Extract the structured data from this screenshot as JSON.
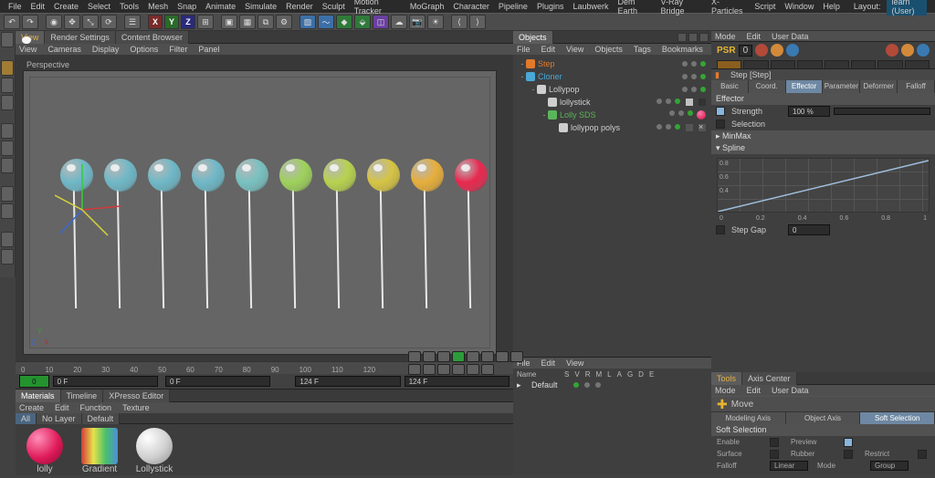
{
  "layout_label": "Layout:",
  "layout_value": "learn (User)",
  "menu": [
    "File",
    "Edit",
    "Create",
    "Select",
    "Tools",
    "Mesh",
    "Snap",
    "Animate",
    "Simulate",
    "Render",
    "Sculpt",
    "Motion Tracker",
    "MoGraph",
    "Character",
    "Pipeline",
    "Plugins",
    "Laubwerk",
    "Dem Earth",
    "V-Ray Bridge",
    "X-Particles",
    "Script",
    "Window",
    "Help"
  ],
  "view_tabs": {
    "view": "View",
    "render_settings": "Render Settings",
    "content_browser": "Content Browser"
  },
  "view_menu": [
    "View",
    "Cameras",
    "Display",
    "Options",
    "Filter",
    "Panel"
  ],
  "perspective": "Perspective",
  "axis": {
    "x": "X",
    "y": "Y",
    "z": "Z"
  },
  "timeline": {
    "marks": [
      "0",
      "10",
      "20",
      "30",
      "40",
      "50",
      "60",
      "70",
      "80",
      "90",
      "100",
      "110",
      "120"
    ],
    "start": "0",
    "start_frame": "0 F",
    "current": "0 F",
    "end": "124 F",
    "end2": "124 F"
  },
  "materials": {
    "tabs": {
      "materials": "Materials",
      "timeline": "Timeline",
      "xpresso": "XPresso Editor"
    },
    "menu": [
      "Create",
      "Edit",
      "Function",
      "Texture"
    ],
    "filters": {
      "all": "All",
      "nolayer": "No Layer",
      "default": "Default"
    },
    "items": [
      {
        "name": "lolly",
        "kind": "ball",
        "color": "#e01b5a"
      },
      {
        "name": "Gradient",
        "kind": "grad"
      },
      {
        "name": "Lollystick",
        "kind": "ball",
        "color": "#d9d9d9"
      }
    ]
  },
  "objects": {
    "tab": "Objects",
    "menu": [
      "File",
      "Edit",
      "View",
      "Objects",
      "Tags",
      "Bookmarks"
    ],
    "tree": [
      {
        "name": "Step",
        "color": "#e27a2a",
        "indent": 0,
        "twist": "-",
        "icon": "step"
      },
      {
        "name": "Cloner",
        "color": "#4aa9d6",
        "indent": 0,
        "twist": "-",
        "icon": "cloner"
      },
      {
        "name": "Lollypop",
        "color": "#cfcfcf",
        "indent": 1,
        "twist": "-",
        "icon": "null"
      },
      {
        "name": "lollystick",
        "color": "#cfcfcf",
        "indent": 2,
        "twist": "",
        "icon": "poly",
        "swatch": true
      },
      {
        "name": "Lolly SDS",
        "color": "#59b559",
        "indent": 2,
        "twist": "-",
        "icon": "sds",
        "redball": true
      },
      {
        "name": "lollypop polys",
        "color": "#cfcfcf",
        "indent": 3,
        "twist": "",
        "icon": "poly",
        "xtag": true
      }
    ]
  },
  "coords_panel": {
    "menu": [
      "File",
      "Edit",
      "View"
    ],
    "headers": [
      "Name",
      "S",
      "V",
      "R",
      "M",
      "L",
      "A",
      "G",
      "D",
      "E"
    ],
    "row_name": "Default"
  },
  "attr": {
    "menu": [
      "Mode",
      "Edit",
      "User Data"
    ],
    "psr": "PSR",
    "psr_val": "0",
    "object_label": "Step [Step]",
    "tabs": [
      "Basic",
      "Coord.",
      "Effector",
      "Parameter",
      "Deformer",
      "Falloff"
    ],
    "groups": {
      "effector": "Effector",
      "minmax": "MinMax",
      "spline": "Spline"
    },
    "rows": {
      "strength": "Strength",
      "strength_val": "100 %",
      "selection": "Selection",
      "stepgap": "Step Gap",
      "stepgap_val": "0"
    },
    "spline_ticks": [
      "0",
      "0.2",
      "0.4",
      "0.6",
      "0.8",
      "1"
    ],
    "spline_yt": [
      "0.8",
      "0.6",
      "0.4"
    ]
  },
  "tools_panel": {
    "tabs": {
      "tools": "Tools",
      "axis": "Axis Center"
    },
    "menu": [
      "Mode",
      "Edit",
      "User Data"
    ],
    "move": "Move",
    "sub_tabs": [
      "Modeling Axis",
      "Object Axis",
      "Soft Selection"
    ],
    "head": "Soft Selection",
    "rows": {
      "enable": "Enable",
      "preview": "Preview",
      "surface": "Surface",
      "rubber": "Rubber",
      "restrict": "Restrict",
      "falloff": "Falloff",
      "linear": "Linear",
      "mode": "Mode",
      "group": "Group"
    }
  },
  "lolly_colors": [
    "#6fb8c7",
    "#6fb8c7",
    "#6fb8c7",
    "#6fb8c7",
    "#79c1c1",
    "#9ed15c",
    "#b7d24e",
    "#d6c444",
    "#e7ae3b",
    "#e8294f"
  ]
}
